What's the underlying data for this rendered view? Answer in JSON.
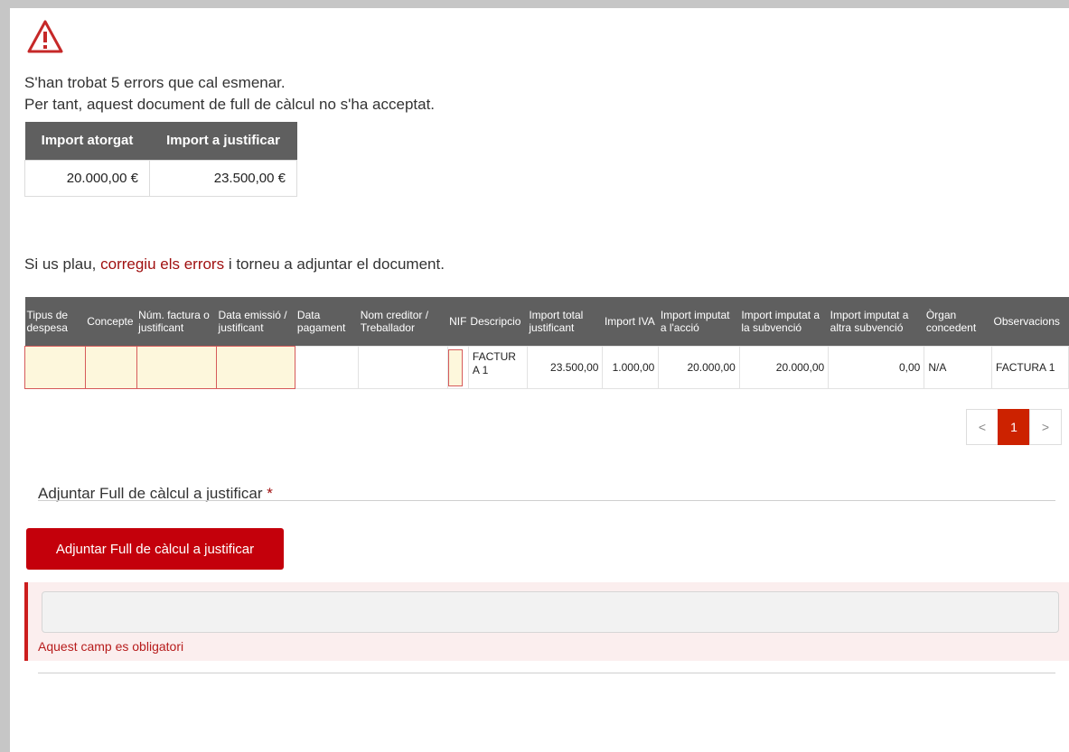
{
  "alert": {
    "icon": "warning-triangle-icon",
    "line1": "S'han trobat 5 errors que cal esmenar.",
    "line2": "Per tant, aquest document de full de càlcul no s'ha acceptat."
  },
  "summary": {
    "headers": [
      "Import atorgat",
      "Import a justificar"
    ],
    "values": [
      "20.000,00 €",
      "23.500,00 €"
    ]
  },
  "instruction": {
    "before": "Si us plau, ",
    "link": "corregiu els errors",
    "after": " i torneu a adjuntar el document."
  },
  "grid": {
    "headers": [
      "Tipus de despesa",
      "Concepte",
      "Núm. factura o justificant",
      "Data emissió / justificant",
      "Data pagament",
      "Nom creditor / Treballador",
      "NIF",
      "Descripcio",
      "Import total justificant",
      "Import IVA",
      "Import imputat a l'acció",
      "Import imputat a la subvenció",
      "Import imputat a altra subvenció",
      "Òrgan concedent",
      "Observacions"
    ],
    "rows": [
      {
        "tipus": "",
        "concepte": "",
        "num_factura": "",
        "data_emissio": "",
        "data_pagament": "",
        "nom_creditor": "",
        "nif": "",
        "descripcio": "FACTURA 1",
        "import_total": "23.500,00",
        "import_iva": "1.000,00",
        "import_accio": "20.000,00",
        "import_subvencio": "20.000,00",
        "import_altra": "0,00",
        "organ": "N/A",
        "observacions": "FACTURA 1"
      }
    ]
  },
  "pagination": {
    "prev": "<",
    "current": "1",
    "next": ">"
  },
  "upload": {
    "label": "Adjuntar Full de càlcul a justificar",
    "required_mark": "*",
    "button": "Adjuntar Full de càlcul a justificar",
    "file_value": "",
    "error": "Aquest camp es obligatori"
  },
  "colors": {
    "primary": "#c4000b",
    "error_text": "#b71c1c",
    "header_bg": "#5f5f5f",
    "error_cell_bg": "#fdf7dc",
    "error_cell_border": "#d65a5a"
  }
}
